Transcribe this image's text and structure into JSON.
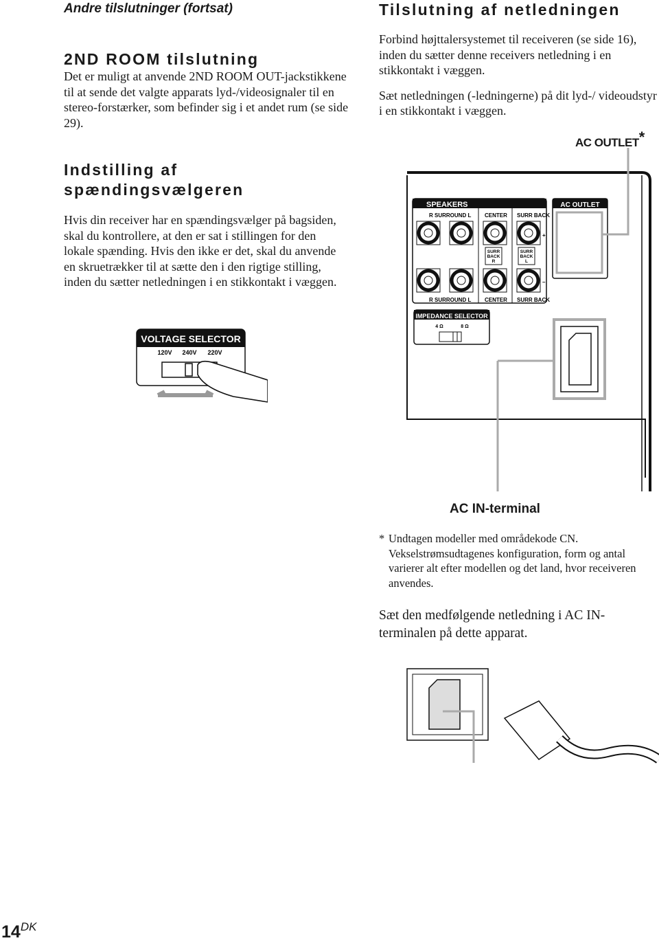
{
  "header": {
    "section": "Andre tilslutninger (fortsat)"
  },
  "left": {
    "room": {
      "title": "2ND ROOM tilslutning",
      "body": "Det er muligt at anvende 2ND ROOM OUT-jackstikkene til at sende det valgte apparats lyd-/videosignaler til en stereo-forstærker, som befinder sig i et andet rum (se side 29)."
    },
    "voltage": {
      "title_line1": "Indstilling af",
      "title_line2": "spændingsvælgeren",
      "body": "Hvis din receiver har en spændingsvælger på bagsiden, skal du kontrollere, at den er sat i stillingen for den lokale spænding. Hvis den ikke er det, skal du anvende en skruetrækker til at sætte den i den rigtige stilling, inden du sætter netledningen i en stikkontakt i væggen.",
      "figure": {
        "label": "VOLTAGE SELECTOR",
        "options": [
          "120V",
          "240V",
          "220V"
        ]
      }
    }
  },
  "right": {
    "title": "Tilslutning af netledningen",
    "para1": "Forbind højttalersystemet til receiveren (se side 16), inden du sætter denne receivers netledning i en stikkontakt i væggen.",
    "para2": "Sæt netledningen (-ledningerne) på dit lyd-/ videoudstyr i en stikkontakt i væggen.",
    "ac_outlet_callout": "AC OUTLET",
    "ac_outlet_mark": "*",
    "panel": {
      "speakers": "SPEAKERS",
      "r_surround_l": "R SURROUND L",
      "center": "CENTER",
      "surr_back": "SURR BACK",
      "surr_back_r": [
        "SURR",
        "BACK",
        "R"
      ],
      "surr_back_l": [
        "SURR",
        "BACK",
        "L"
      ],
      "plus": "+",
      "minus": "–",
      "ac_outlet": "AC  OUTLET",
      "impedance": "IMPEDANCE SELECTOR",
      "imp_4": "4 Ω",
      "imp_8": "8 Ω"
    },
    "ac_in_label": "AC IN-terminal",
    "footnote_mark": "*",
    "footnote": "Undtagen modeller med områdekode CN. Vekselstrømsudtagenes konfiguration, form og antal varierer alt efter modellen og det land, hvor receiveren anvendes.",
    "para3": "Sæt den medfølgende netledning i AC IN-terminalen på dette apparat."
  },
  "footer": {
    "page": "14",
    "suffix": "DK"
  }
}
